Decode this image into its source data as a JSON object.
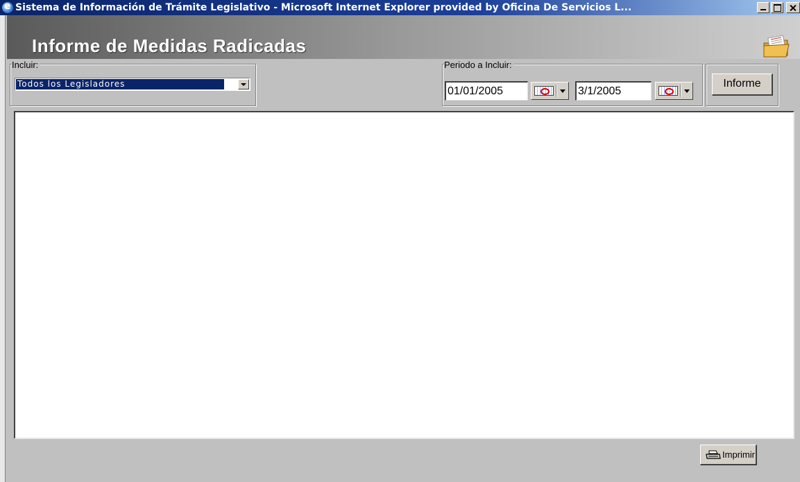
{
  "window": {
    "title": "Sistema de Información de Trámite Legislativo - Microsoft Internet Explorer provided by Oficina De Servicios L..."
  },
  "header": {
    "title": "Informe de Medidas Radicadas",
    "icon": "folder-document-icon"
  },
  "filters": {
    "incluir_label": "Incluir:",
    "incluir_selected": "Todos los Legisladores",
    "periodo_label": "Periodo a Incluir:",
    "date_from": "01/01/2005",
    "date_to": "3/1/2005",
    "informe_button": "Informe"
  },
  "footer": {
    "print_button": "Imprimir"
  },
  "colors": {
    "titlebar": "#0a246a",
    "face": "#c0c0c0",
    "selection": "#0a246a"
  }
}
